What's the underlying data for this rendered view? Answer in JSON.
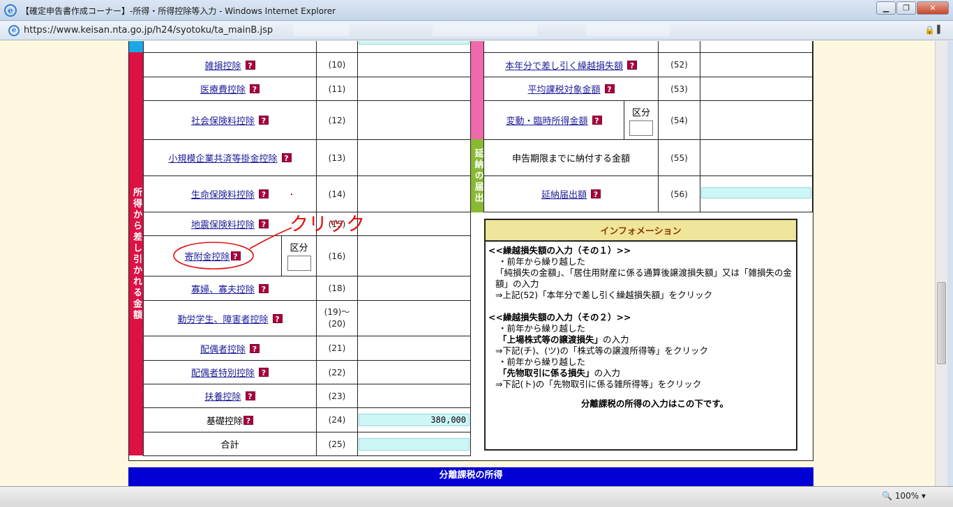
{
  "window": {
    "title": "【確定申告書作成コーナー】-所得・所得控除等入力 - Windows Internet Explorer",
    "url": "https://www.keisan.nta.go.jp/h24/syotoku/ta_mainB.jsp",
    "zoom": "100%"
  },
  "colors": {
    "deduction_band": "#dd1144",
    "pink_band": "#ee6aad",
    "green_band": "#88bb33",
    "blue_bar": "#0000d4",
    "help_icon": "#a8003f",
    "cyan_input": "#cdf6f6"
  },
  "left_band_label": "所得から差し引かれる金額",
  "left_rows": [
    {
      "label": "雑損控除",
      "number": "(10)"
    },
    {
      "label": "医療費控除",
      "number": "(11)"
    },
    {
      "label": "社会保険料控除",
      "number": "(12)"
    },
    {
      "label": "小規模企業共済等掛金控除",
      "number": "(13)"
    },
    {
      "label": "生命保険料控除",
      "number": "(14)"
    },
    {
      "label": "地震保険料控除",
      "number": "(15)"
    },
    {
      "label": "寄附金控除",
      "number": "(16)",
      "kubun": "区分"
    },
    {
      "label": "寡婦、寡夫控除",
      "number": "(18)"
    },
    {
      "label": "勤労学生、障害者控除",
      "number": "(19)～(20)"
    },
    {
      "label": "配偶者控除",
      "number": "(21)"
    },
    {
      "label": "配偶者特別控除",
      "number": "(22)"
    },
    {
      "label": "扶養控除",
      "number": "(23)"
    },
    {
      "label": "基礎控除",
      "number": "(24)",
      "value": "380,000"
    },
    {
      "label": "合計",
      "number": "(25)"
    }
  ],
  "right_rows": [
    {
      "label": "本年分で差し引く繰越損失額",
      "number": "(52)"
    },
    {
      "label": "平均課税対象金額",
      "number": "(53)"
    },
    {
      "label": "変動・臨時所得金額",
      "number": "(54)",
      "kubun": "区分"
    },
    {
      "label": "申告期限までに納付する金額",
      "number": "(55)"
    },
    {
      "label": "延納届出額",
      "number": "(56)"
    }
  ],
  "green_band_label": "延納の届出",
  "annotation": "クリック",
  "info": {
    "header": "インフォメーション",
    "lines": [
      "<<繰越損失額の入力（その１）>>",
      "・前年から繰り越した",
      "「純損失の金額」、「居住用財産に係る通算後譲渡損失額」又は「雑損失の金額」の入力",
      "⇒上記(52)「本年分で差し引く繰越損失額」をクリック",
      "<<繰越損失額の入力（その２）>>",
      "・前年から繰り越した",
      "「上場株式等の譲渡損失」",
      "の入力",
      "⇒下記(チ)、(ツ)の「株式等の譲渡所得等」をクリック",
      "・前年から繰り越した",
      "「先物取引に係る損失」",
      "の入力",
      "⇒下記(ト)の「先物取引に係る雑所得等」をクリック",
      "分離課税の所得の入力はこの下です。"
    ]
  },
  "blue_bar_title": "分離課税の所得"
}
